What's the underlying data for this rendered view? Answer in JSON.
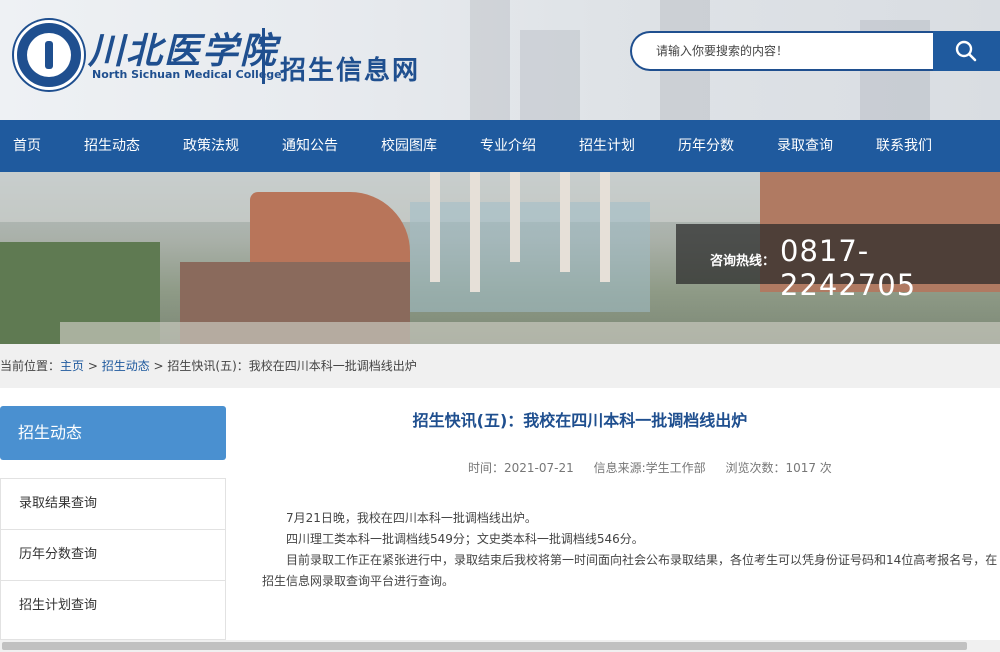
{
  "header": {
    "logo_cn": "川北医学院",
    "logo_en": "North Sichuan Medical College",
    "site_title": "招生信息网",
    "search_placeholder": "请输入你要搜索的内容！",
    "search_icon": "search-icon"
  },
  "nav": {
    "items": [
      {
        "label": "首页"
      },
      {
        "label": "招生动态"
      },
      {
        "label": "政策法规"
      },
      {
        "label": "通知公告"
      },
      {
        "label": "校园图库"
      },
      {
        "label": "专业介绍"
      },
      {
        "label": "招生计划"
      },
      {
        "label": "历年分数"
      },
      {
        "label": "录取查询"
      },
      {
        "label": "联系我们"
      }
    ]
  },
  "banner": {
    "hotline_label": "咨询热线：",
    "hotline_number": "0817-2242705"
  },
  "breadcrumb": {
    "prefix": "当前位置：",
    "home": "主页",
    "sep1": " > ",
    "section": "招生动态",
    "sep2": " > ",
    "current": "招生快讯(五)：我校在四川本科一批调档线出炉"
  },
  "sidebar": {
    "title": "招生动态",
    "items": [
      {
        "label": "录取结果查询"
      },
      {
        "label": "历年分数查询"
      },
      {
        "label": "招生计划查询"
      }
    ]
  },
  "article": {
    "title": "招生快讯(五)：我校在四川本科一批调档线出炉",
    "time": "时间：2021-07-21",
    "source": "信息来源:学生工作部",
    "views": "浏览次数：1017 次",
    "p1": "7月21日晚，我校在四川本科一批调档线出炉。",
    "p2": "四川理工类本科一批调档线549分；文史类本科一批调档线546分。",
    "p3": "目前录取工作正在紧张进行中，录取结束后我校将第一时间面向社会公布录取结果，各位考生可以凭身份证号码和14位高考报名号，在",
    "p3_cont": "招生信息网录取查询平台进行查询。"
  },
  "colors": {
    "primary": "#1f5a9e",
    "sidebar_title": "#4a90d0",
    "title_text": "#1f4f8f"
  }
}
